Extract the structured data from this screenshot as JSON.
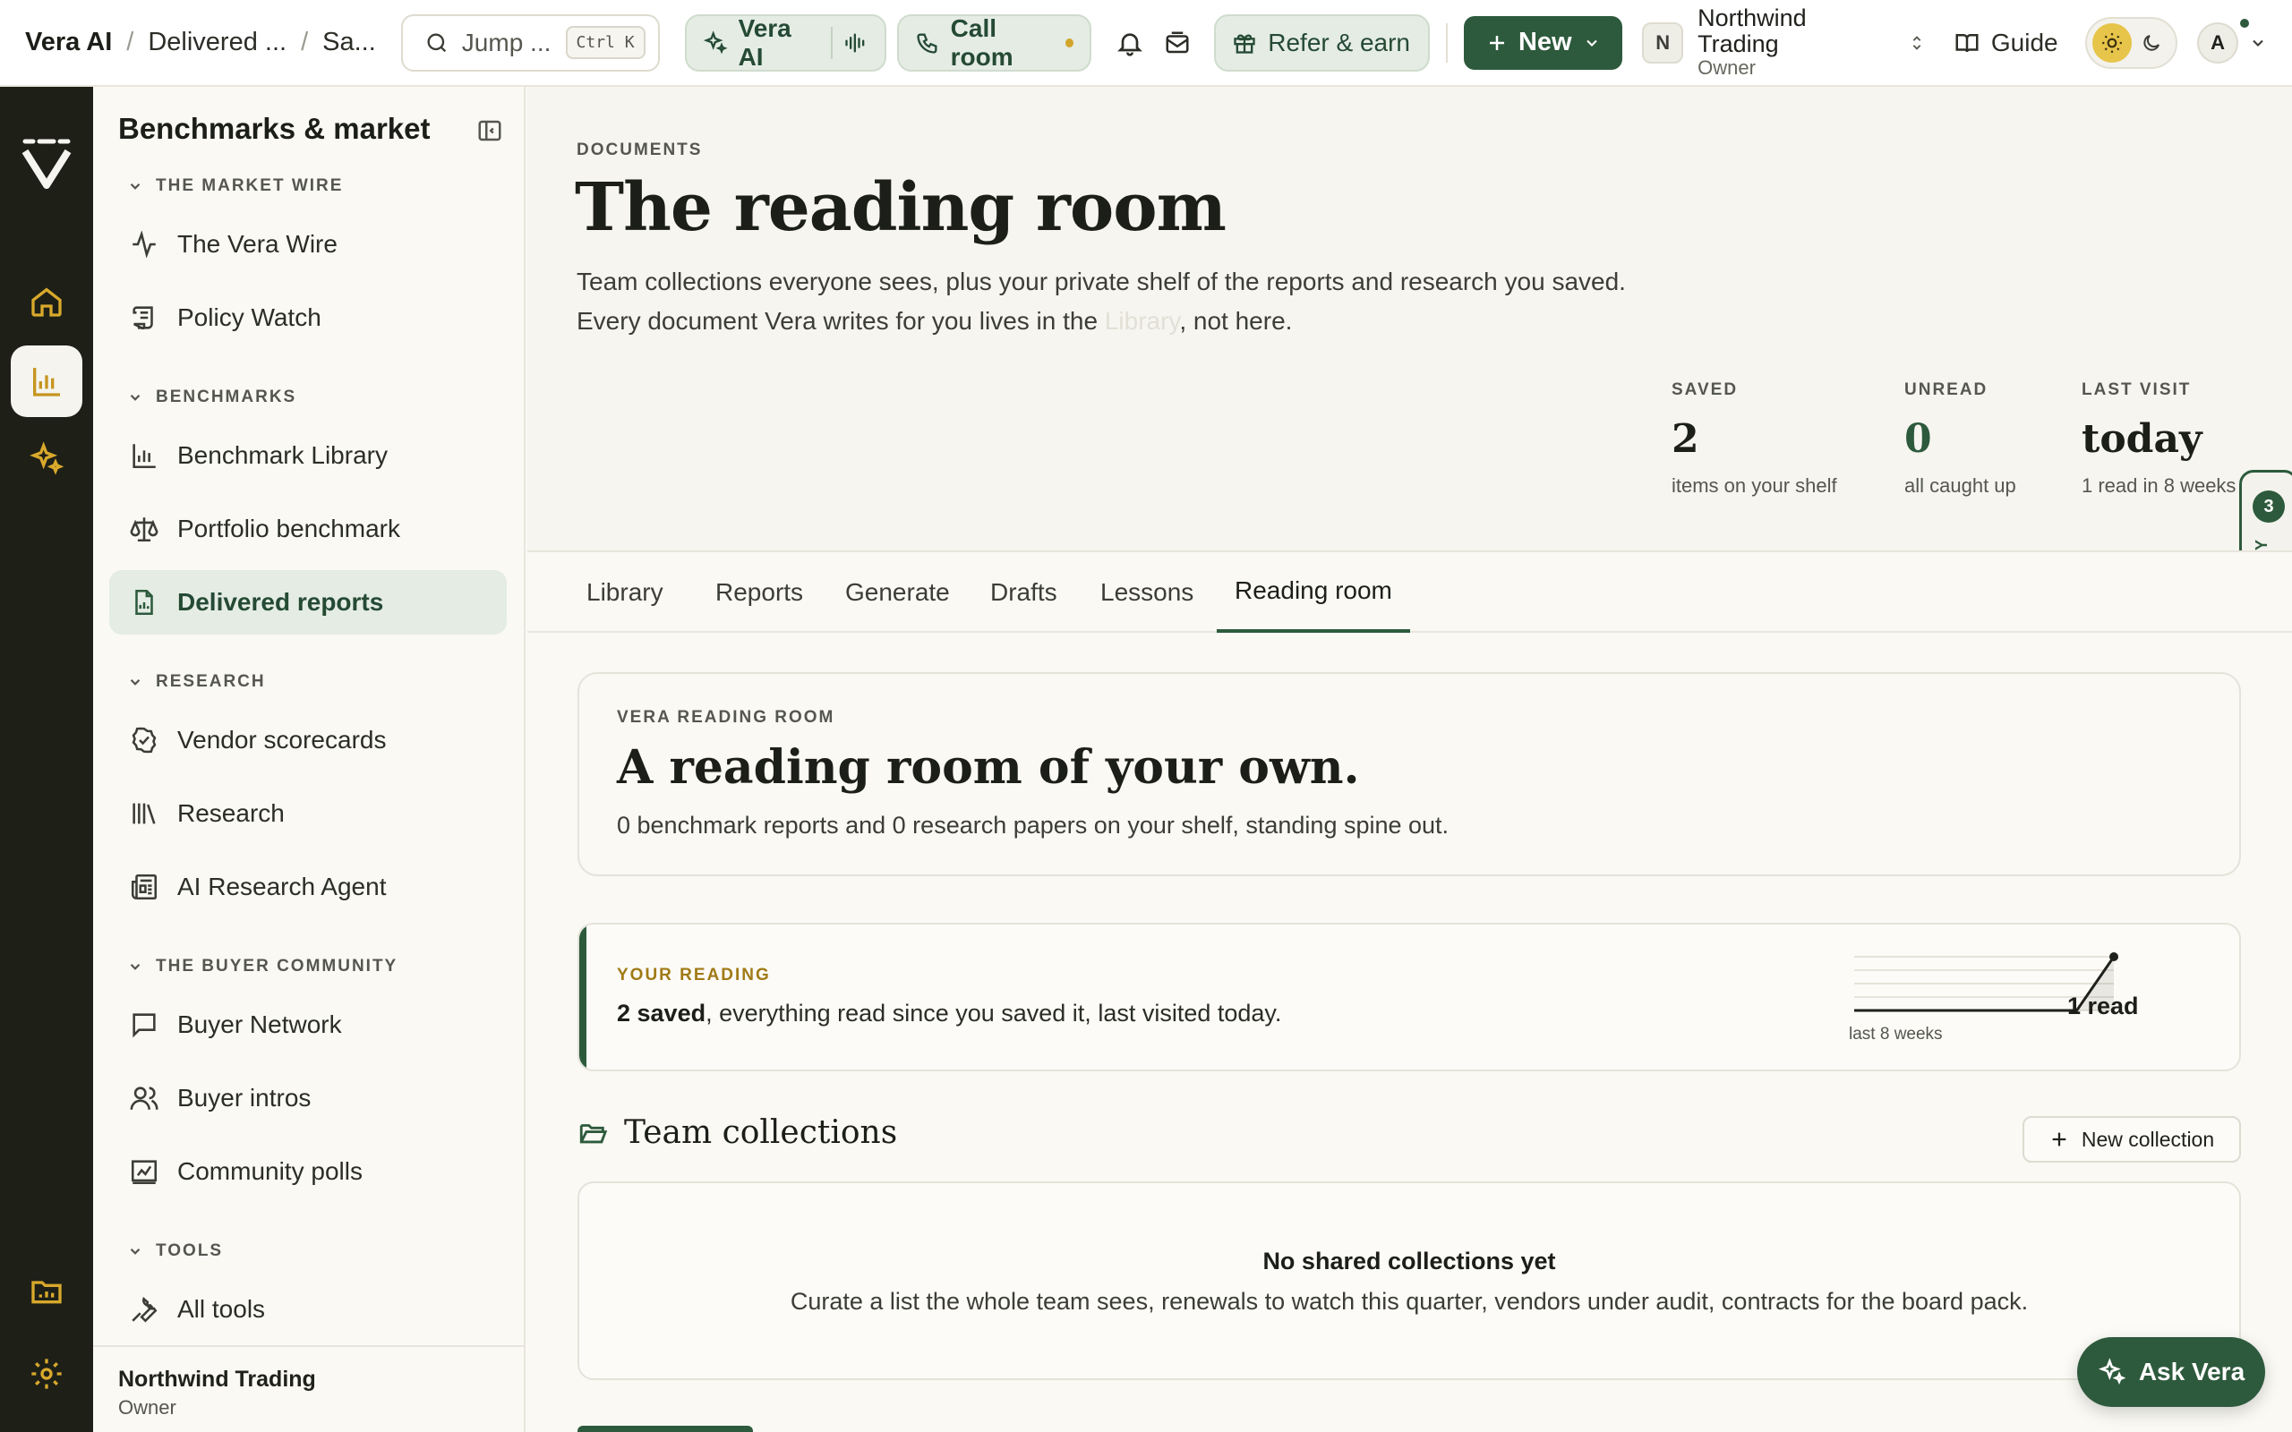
{
  "breadcrumb": [
    "Vera AI",
    "Delivered ...",
    "Sa..."
  ],
  "search": {
    "placeholder": "Jump ...",
    "shortcut": "Ctrl K"
  },
  "header": {
    "vera_label": "Vera AI",
    "call_label": "Call room",
    "refer_label": "Refer & earn",
    "new_label": "New",
    "org_initial": "N",
    "org_name": "Northwind Trading",
    "org_role": "Owner",
    "guide_label": "Guide",
    "user_initial": "A"
  },
  "sidebar": {
    "title": "Benchmarks & market",
    "sections": [
      {
        "label": "THE MARKET WIRE",
        "items": [
          {
            "label": "The Vera Wire",
            "icon": "activity-icon"
          },
          {
            "label": "Policy Watch",
            "icon": "scroll-icon"
          }
        ]
      },
      {
        "label": "BENCHMARKS",
        "items": [
          {
            "label": "Benchmark Library",
            "icon": "bar-chart-icon"
          },
          {
            "label": "Portfolio benchmark",
            "icon": "scale-icon"
          },
          {
            "label": "Delivered reports",
            "icon": "report-icon",
            "active": true
          }
        ]
      },
      {
        "label": "RESEARCH",
        "items": [
          {
            "label": "Vendor scorecards",
            "icon": "badge-check-icon"
          },
          {
            "label": "Research",
            "icon": "library-icon"
          },
          {
            "label": "AI Research Agent",
            "icon": "newspaper-icon"
          }
        ]
      },
      {
        "label": "THE BUYER COMMUNITY",
        "items": [
          {
            "label": "Buyer Network",
            "icon": "message-square-icon"
          },
          {
            "label": "Buyer intros",
            "icon": "users-icon"
          },
          {
            "label": "Community polls",
            "icon": "poll-icon"
          }
        ]
      },
      {
        "label": "TOOLS",
        "items": [
          {
            "label": "All tools",
            "icon": "wrench-icon"
          }
        ]
      }
    ],
    "footer": {
      "name": "Northwind Trading",
      "role": "Owner"
    }
  },
  "page": {
    "eyebrow": "DOCUMENTS",
    "title": "The reading room",
    "intro_1": "Team collections everyone sees, plus your private shelf of the reports and research you saved. Every document Vera writes for you lives in the ",
    "intro_link": "Library",
    "intro_2": ", not here.",
    "stats": [
      {
        "label": "SAVED",
        "value": "2",
        "sub": "items on your shelf"
      },
      {
        "label": "UNREAD",
        "value": "0",
        "sub": "all caught up"
      },
      {
        "label": "LAST VISIT",
        "value": "today",
        "sub": "1 read in 8 weeks"
      }
    ],
    "ready_count": "3",
    "ready_label": "READY"
  },
  "tabs": [
    {
      "label": "Library"
    },
    {
      "label": "Reports"
    },
    {
      "label": "Generate"
    },
    {
      "label": "Drafts"
    },
    {
      "label": "Lessons"
    },
    {
      "label": "Reading room",
      "active": true
    }
  ],
  "reading_room_card": {
    "eyebrow": "VERA READING ROOM",
    "title": "A reading room of your own.",
    "subtitle": "0 benchmark reports and 0 research papers on your shelf, standing spine out."
  },
  "your_reading": {
    "eyebrow": "YOUR READING",
    "saved_bold": "2 saved",
    "text": ", everything read since you saved it, last visited today.",
    "spark_caption": "last 8 weeks",
    "reads_label": "1 read",
    "weekly_reads": [
      0,
      0,
      0,
      0,
      0,
      0,
      0,
      1
    ]
  },
  "team_collections": {
    "title": "Team collections",
    "new_button": "New collection",
    "empty_title": "No shared collections yet",
    "empty_desc": "Curate a list the whole team sees, renewals to watch this quarter, vendors under audit, contracts for the board pack."
  },
  "ask_vera": "Ask Vera",
  "colors": {
    "brand_green": "#2d5a3c",
    "accent_amber": "#d2a52a",
    "rail_dark": "#1e2017"
  }
}
